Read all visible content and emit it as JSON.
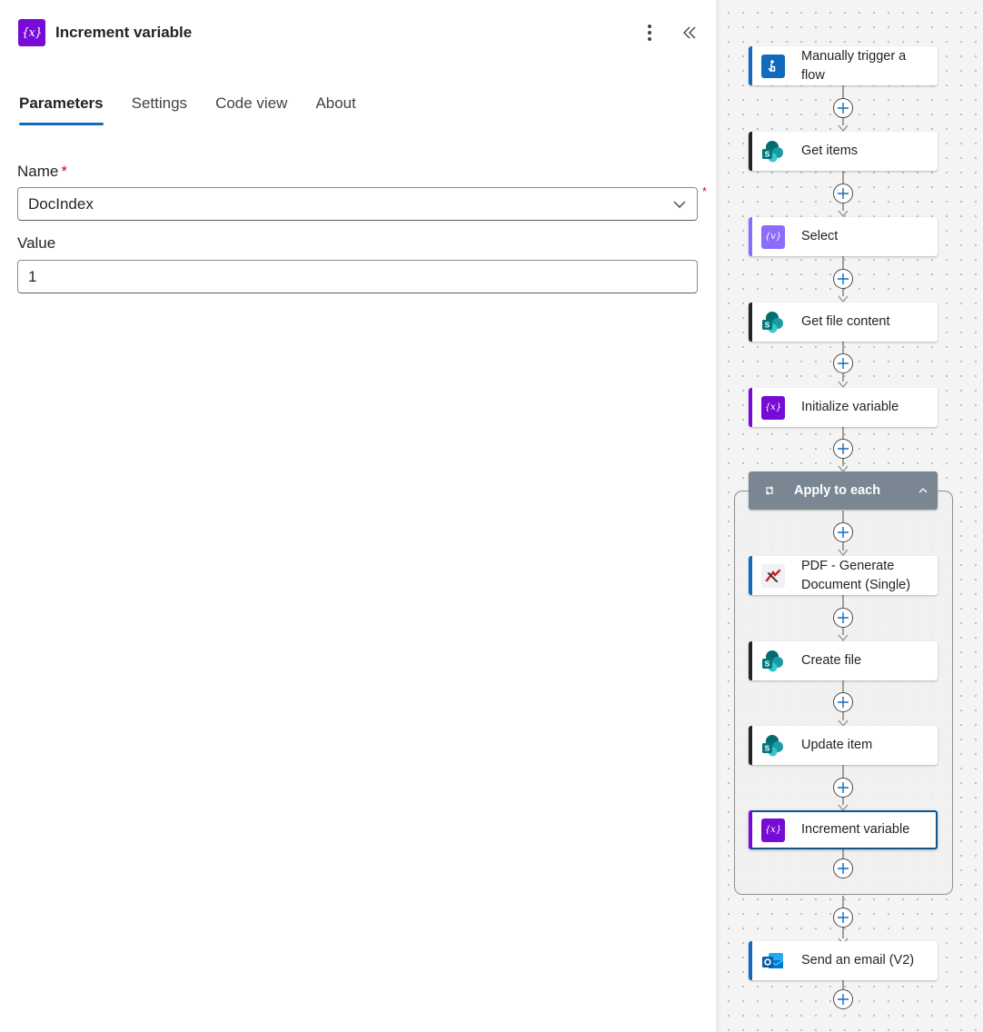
{
  "panel": {
    "title": "Increment variable",
    "action_icon": "variable-icon",
    "icons": {
      "more": "more-vertical-icon",
      "collapse": "double-chevron-left-icon"
    },
    "tabs": [
      {
        "label": "Parameters",
        "active": true
      },
      {
        "label": "Settings",
        "active": false
      },
      {
        "label": "Code view",
        "active": false
      },
      {
        "label": "About",
        "active": false
      }
    ],
    "fields": {
      "name": {
        "label": "Name",
        "required_mark": "*",
        "value": "DocIndex"
      },
      "value": {
        "label": "Value",
        "value": "1"
      }
    }
  },
  "flow": {
    "steps": [
      {
        "label": "Manually trigger a flow",
        "icon": "manual-trigger-icon",
        "accent": "#0f6cbd"
      },
      {
        "label": "Get items",
        "icon": "sharepoint-icon",
        "accent": "#242424"
      },
      {
        "label": "Select",
        "icon": "data-operation-icon",
        "accent": "#8c6cff"
      },
      {
        "label": "Get file content",
        "icon": "sharepoint-icon",
        "accent": "#242424"
      },
      {
        "label": "Initialize variable",
        "icon": "variable-icon",
        "accent": "#770bd6"
      }
    ],
    "scope": {
      "label": "Apply to each",
      "icon": "loop-icon",
      "steps": [
        {
          "label": "PDF - Generate Document (Single)",
          "icon": "pdf-document-icon",
          "accent": "#0f6cbd"
        },
        {
          "label": "Create file",
          "icon": "sharepoint-icon",
          "accent": "#242424"
        },
        {
          "label": "Update item",
          "icon": "sharepoint-icon",
          "accent": "#242424"
        },
        {
          "label": "Increment variable",
          "icon": "variable-icon",
          "accent": "#770bd6",
          "selected": true
        }
      ]
    },
    "after": [
      {
        "label": "Send an email (V2)",
        "icon": "outlook-icon",
        "accent": "#0f6cbd"
      }
    ]
  },
  "colors": {
    "variable": "#770bd6",
    "data_operation": "#8c6cff",
    "tab_underline": "#0f6cbd",
    "required": "#c50f1f",
    "scope_header": "#7a8793",
    "selected_border": "#0f548c",
    "plus_icon": "#0f6cbd"
  }
}
